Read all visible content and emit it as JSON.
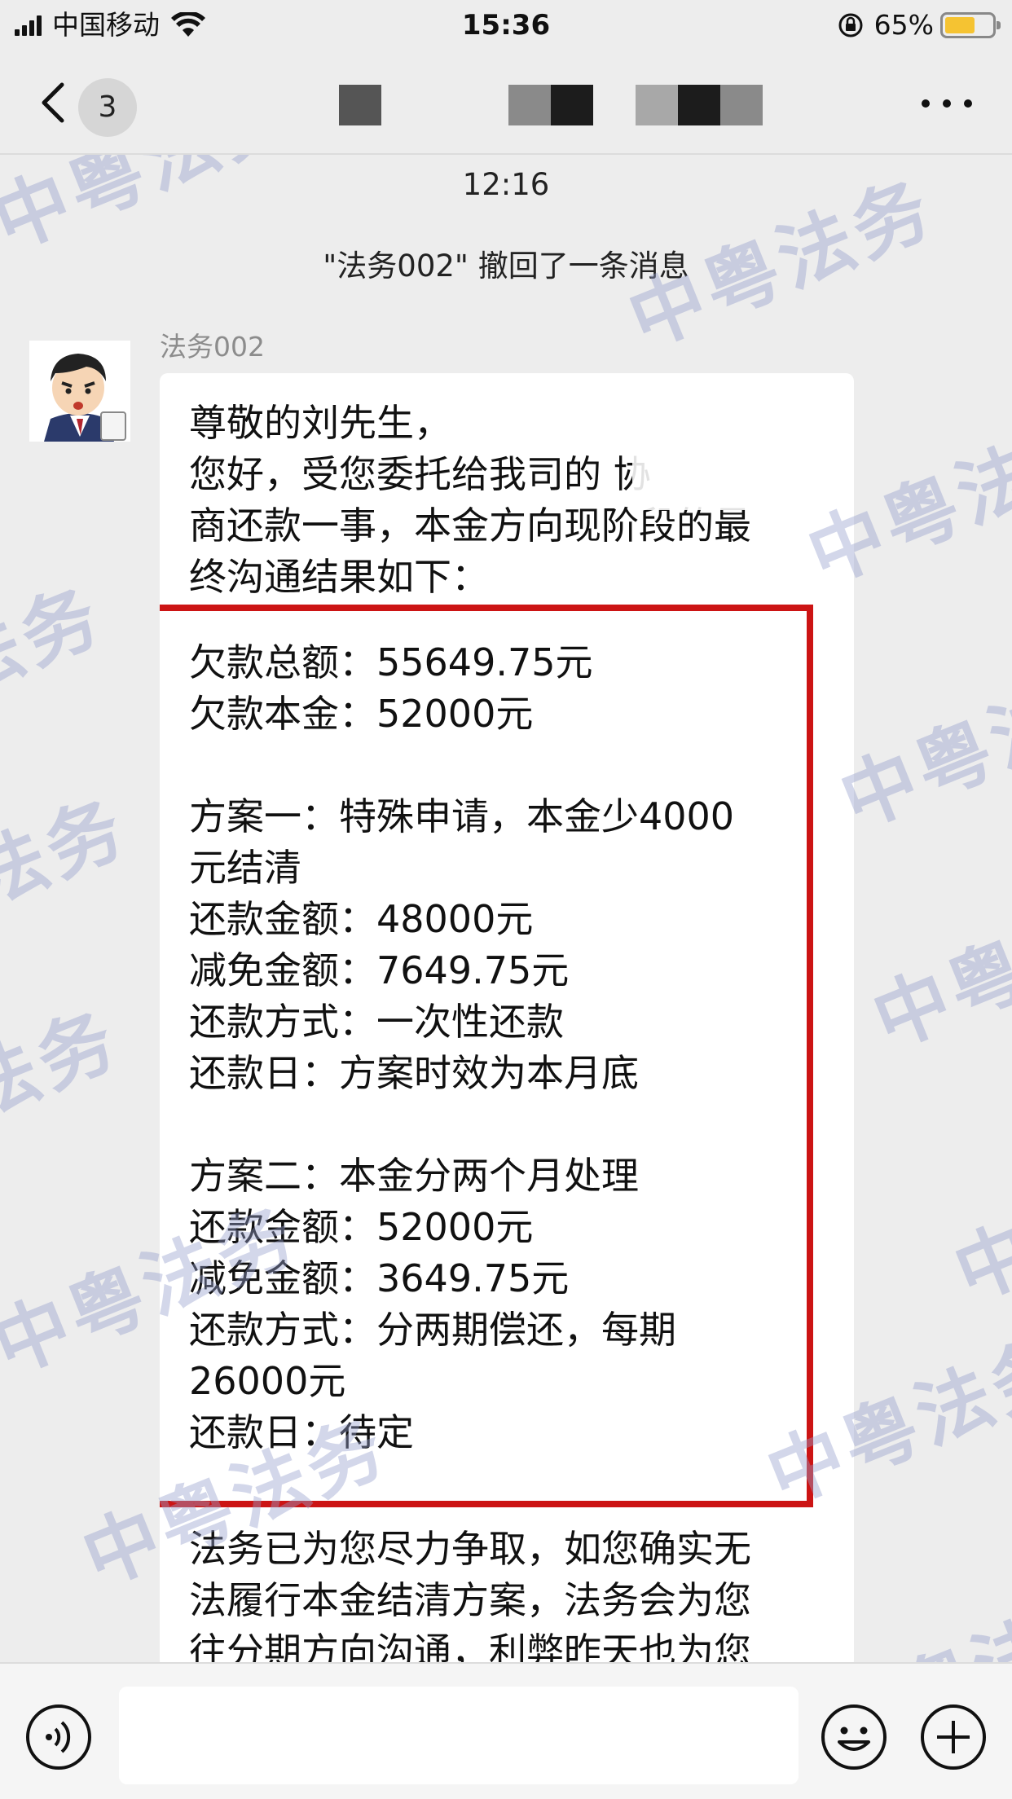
{
  "status_bar": {
    "carrier": "中国移动",
    "time": "15:36",
    "battery_percent": "65%",
    "battery_level": 0.65,
    "battery_color": "#f5c332"
  },
  "nav": {
    "back_icon": "chevron-left-icon",
    "unread_count": "3",
    "title": "[redacted]",
    "more_icon": "ellipsis-icon"
  },
  "watermark": {
    "text": "中粤法务"
  },
  "chat": {
    "timestamp": "12:16",
    "recall_notice": "\"法务002\" 撤回了一条消息",
    "message": {
      "sender": "法务002",
      "intro_lines": [
        "尊敬的刘先生，",
        "您好，受您委托给我司的        协",
        "商还款一事，本金方向现阶段的最",
        "终沟通结果如下："
      ],
      "boxed_lines": [
        "欠款总额：55649.75元",
        "欠款本金：52000元",
        "",
        "方案一：特殊申请，本金少4000",
        "元结清",
        "还款金额：48000元",
        "减免金额：7649.75元",
        "还款方式：一次性还款",
        "还款日：方案时效为本月底",
        "",
        "方案二：本金分两个月处理",
        "还款金额：52000元",
        "减免金额：3649.75元",
        "还款方式：分两期偿还，每期",
        "26000元",
        "还款日：待定"
      ],
      "outro_lines": [
        "法务已为您尽力争取，如您确实无",
        "法履行本金结清方案，法务会为您",
        "往分期方向沟通，利弊昨天也为您"
      ]
    }
  },
  "input_bar": {
    "voice_icon": "voice-icon",
    "emoji_icon": "emoji-icon",
    "plus_icon": "plus-icon"
  },
  "colors": {
    "highlight_border": "#cc1414",
    "watermark": "#96a0cd",
    "background": "#ededed"
  }
}
